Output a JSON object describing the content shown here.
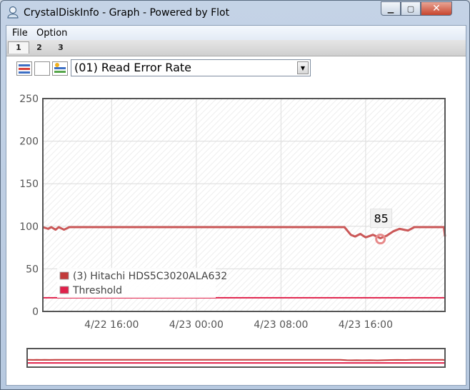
{
  "window": {
    "title": "CrystalDiskInfo - Graph - Powered by Flot"
  },
  "menu": {
    "file": "File",
    "option": "Option"
  },
  "tabs": [
    {
      "label": "1",
      "active": true
    },
    {
      "label": "2"
    },
    {
      "label": "3"
    }
  ],
  "toolbar": {
    "icons": [
      "select-all-icon",
      "select-none-icon",
      "refresh-icon"
    ],
    "attribute_select": "(01) Read Error Rate"
  },
  "chart_data": {
    "type": "line",
    "xlabel": "",
    "ylabel": "",
    "ylim": [
      0,
      250
    ],
    "y_ticks": [
      "0",
      "50",
      "100",
      "150",
      "200",
      "250"
    ],
    "x_tick_labels": [
      "4/22 16:00",
      "4/23 00:00",
      "4/23 08:00",
      "4/23 16:00"
    ],
    "x_ticks_hours": [
      16,
      24,
      32,
      40
    ],
    "xlim_hours": [
      9.5,
      47.5
    ],
    "grid": true,
    "legend_position": "bottom-left",
    "series": [
      {
        "name": "(3) Hitachi HDS5C3020ALA632",
        "color": "#c23b3b",
        "x": [
          9.5,
          10.0,
          10.3,
          10.7,
          11.0,
          11.5,
          12.0,
          12.5,
          25.0,
          38.0,
          38.6,
          39.0,
          39.5,
          40.0,
          40.7,
          41.4,
          42.0,
          42.6,
          43.2,
          44.0,
          44.6,
          45.0,
          47.4,
          47.5
        ],
        "y": [
          99,
          97,
          99,
          96,
          99,
          96,
          99,
          99,
          99,
          99,
          90,
          88,
          91,
          87,
          90,
          86,
          89,
          94,
          97,
          95,
          99,
          99,
          99,
          88
        ]
      },
      {
        "name": "Threshold",
        "color": "#e0204a",
        "x": [
          9.5,
          47.5
        ],
        "y": [
          16,
          16
        ]
      }
    ],
    "tooltip": {
      "value": "85",
      "x": 41.4,
      "y": 85
    }
  }
}
